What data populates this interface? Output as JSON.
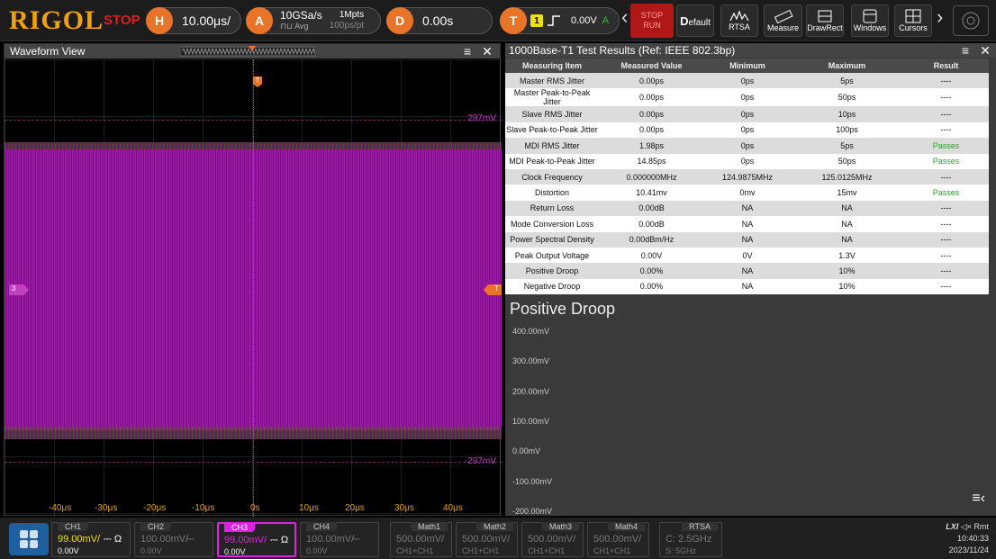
{
  "topbar": {
    "logo": "RIGOL",
    "run_state": "STOP",
    "horizontal": {
      "key": "H",
      "value": "10.00μs/"
    },
    "acquire": {
      "key": "A",
      "rate": "10GSa/s",
      "mode": "Avg",
      "depth": "1Mpts",
      "per_pt": "100ps/pt"
    },
    "delay": {
      "key": "D",
      "value": "0.00s"
    },
    "trigger": {
      "key": "T",
      "source": "1",
      "level": "0.00V",
      "mode": "A"
    },
    "run_stop": {
      "top": "STOP",
      "bottom": "RUN"
    },
    "buttons": [
      "Default",
      "RTSA",
      "Measure",
      "DrawRect",
      "Windows",
      "Cursors"
    ],
    "default_prefix": "D",
    "default_suffix": "efault"
  },
  "waveform": {
    "title": "Waveform View",
    "upper_level": "297mV",
    "lower_level": "-297mV",
    "channel_marker": "3",
    "trigger_marker": "T",
    "x_ticks": [
      "-40μs",
      "-30μs",
      "-20μs",
      "-10μs",
      "0s",
      "10μs",
      "20μs",
      "30μs",
      "40μs"
    ],
    "trace_color": "#a020aa"
  },
  "results": {
    "title": "1000Base-T1 Test Results (Ref: IEEE 802.3bp)",
    "headers": [
      "Measuring Item",
      "Measured Value",
      "Minimum",
      "Maximum",
      "Result"
    ],
    "rows": [
      [
        "Master RMS Jitter",
        "0.00ps",
        "0ps",
        "5ps",
        "----"
      ],
      [
        "Master Peak-to-Peak Jitter",
        "0.00ps",
        "0ps",
        "50ps",
        "----"
      ],
      [
        "Slave RMS Jitter",
        "0.00ps",
        "0ps",
        "10ps",
        "----"
      ],
      [
        "Slave Peak-to-Peak Jitter",
        "0.00ps",
        "0ps",
        "100ps",
        "----"
      ],
      [
        "MDI RMS Jitter",
        "1.98ps",
        "0ps",
        "5ps",
        "Passes"
      ],
      [
        "MDI Peak-to-Peak Jitter",
        "14.85ps",
        "0ps",
        "50ps",
        "Passes"
      ],
      [
        "Clock Frequency",
        "0.000000MHz",
        "124.9875MHz",
        "125.0125MHz",
        "----"
      ],
      [
        "Distortion",
        "10.41mv",
        "0mv",
        "15mv",
        "Passes"
      ],
      [
        "Return Loss",
        "0.00dB",
        "NA",
        "NA",
        "----"
      ],
      [
        "Mode Conversion Loss",
        "0.00dB",
        "NA",
        "NA",
        "----"
      ],
      [
        "Power Spectral Density",
        "0.00dBm/Hz",
        "NA",
        "NA",
        "----"
      ],
      [
        "Peak Output Voltage",
        "0.00V",
        "0V",
        "1.3V",
        "----"
      ],
      [
        "Positive Droop",
        "0.00%",
        "NA",
        "10%",
        "----"
      ],
      [
        "Negative Droop",
        "0.00%",
        "NA",
        "10%",
        "----"
      ]
    ],
    "chart_title": "Positive Droop",
    "y_ticks": [
      "400.00mV",
      "300.00mV",
      "200.00mV",
      "100.00mV",
      "0.00mV",
      "-100.00mV",
      "-200.00mV"
    ]
  },
  "bottombar": {
    "channels": [
      {
        "label": "CH1",
        "scale": "99.00mV/",
        "coupling": "⎓ Ω",
        "offset": "0.00V",
        "color": "#f0e000"
      },
      {
        "label": "CH2",
        "scale": "100.00mV/",
        "coupling": "⎓",
        "offset": "0.00V",
        "color": "#777777"
      },
      {
        "label": "CH3",
        "scale": "99.00mV/",
        "coupling": "⎓ Ω",
        "offset": "0.00V",
        "color": "#e020e0"
      },
      {
        "label": "CH4",
        "scale": "100.00mV/",
        "coupling": "⎓",
        "offset": "0.00V",
        "color": "#777777"
      }
    ],
    "maths": [
      {
        "label": "Math1",
        "scale": "500.00mV/",
        "src": "CH1+CH1"
      },
      {
        "label": "Math2",
        "scale": "500.00mV/",
        "src": "CH1+CH1"
      },
      {
        "label": "Math3",
        "scale": "500.00mV/",
        "src": "CH1+CH1"
      },
      {
        "label": "Math4",
        "scale": "500.00mV/",
        "src": "CH1+CH1"
      }
    ],
    "rtsa": {
      "label": "RTSA",
      "center": "C: 2.5GHz",
      "span": "S: 5GHz"
    },
    "status": "LXI",
    "status_extra": "◁× Rmt",
    "time": "10:40:33",
    "date": "2023/11/24"
  }
}
